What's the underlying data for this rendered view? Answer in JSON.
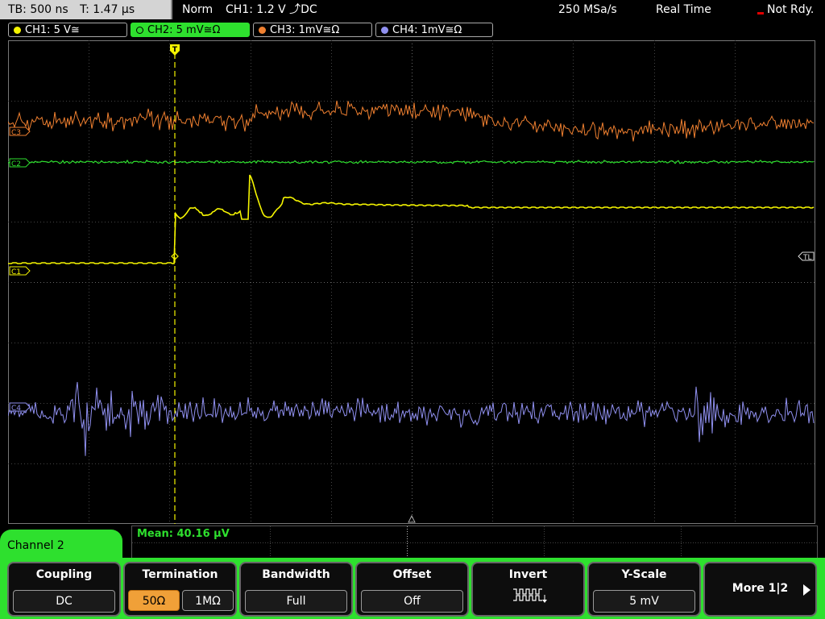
{
  "topbar": {
    "timebase": "TB: 500 ns",
    "trigger_time": "T: 1.47 µs",
    "mode": "Norm",
    "trigger": "CH1: 1.2 V ⤴DC",
    "sample_rate": "250 MSa/s",
    "acq_mode": "Real Time",
    "status": "Not Rdy."
  },
  "channels": [
    {
      "label": "CH1: 5 V≅",
      "color": "#f5f500"
    },
    {
      "label": "CH2: 5 mV≅Ω",
      "color": "#2ee02e"
    },
    {
      "label": "CH3: 1mV≅Ω",
      "color": "#f08030"
    },
    {
      "label": "CH4: 1mV≅Ω",
      "color": "#9090f0"
    }
  ],
  "markers": {
    "c3": "C3",
    "c2": "C2",
    "c1": "C1",
    "c4": "C4",
    "tl": "TL",
    "trigger": "T"
  },
  "measurement": {
    "label": "Mean: 40.16 µV"
  },
  "menu": {
    "channel_tab": "Channel 2",
    "coupling": {
      "title": "Coupling",
      "value": "DC"
    },
    "termination": {
      "title": "Termination",
      "opt1": "50Ω",
      "opt2": "1MΩ"
    },
    "bandwidth": {
      "title": "Bandwidth",
      "value": "Full"
    },
    "offset": {
      "title": "Offset",
      "value": "Off"
    },
    "invert": {
      "title": "Invert"
    },
    "yscale": {
      "title": "Y-Scale",
      "value": "5 mV"
    },
    "more": {
      "label": "More 1|2"
    }
  },
  "colors": {
    "ch1": "#f5f500",
    "ch2": "#2ee02e",
    "ch3": "#f08030",
    "ch4": "#9090f0",
    "accent": "#2ee02e",
    "active_option": "#f0a038"
  }
}
